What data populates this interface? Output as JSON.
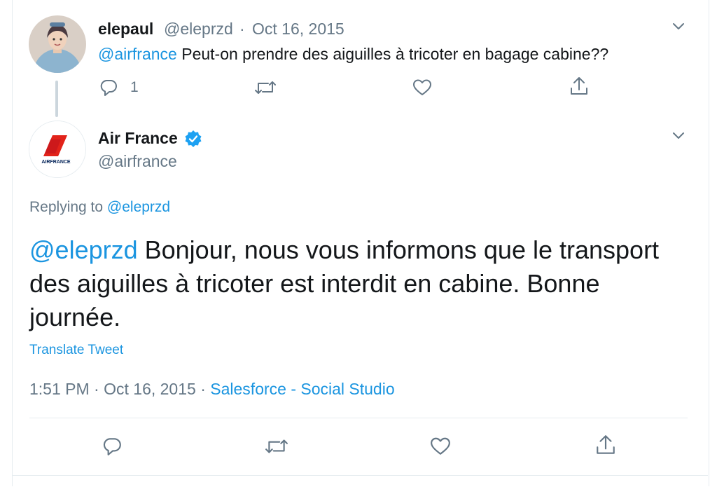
{
  "parent_tweet": {
    "name": "elepaul",
    "handle": "@eleprzd",
    "separator": "·",
    "date": "Oct 16, 2015",
    "mention": "@airfrance",
    "text": " Peut-on prendre des aiguilles à tricoter en bagage cabine??",
    "reply_count": "1",
    "icons": [
      "reply-icon",
      "retweet-icon",
      "like-icon",
      "share-icon",
      "chevron-down-icon"
    ]
  },
  "main_tweet": {
    "name": "Air France",
    "verified": true,
    "handle": "@airfrance",
    "replying_label": "Replying to ",
    "replying_handle": "@eleprzd",
    "mention": "@eleprzd",
    "text": " Bonjour, nous vous informons que le transport des aiguilles à tricoter est interdit en cabine. Bonne journée.",
    "translate_label": "Translate Tweet",
    "time": "1:51 PM",
    "separator": " · ",
    "date": "Oct 16, 2015",
    "source": "Salesforce - Social Studio",
    "logo_text": "AIRFRANCE",
    "icons": [
      "reply-icon",
      "retweet-icon",
      "like-icon",
      "share-icon",
      "chevron-down-icon",
      "verified-badge-icon"
    ]
  },
  "colors": {
    "link": "#1b95e0",
    "secondary_text": "#657786",
    "primary_text": "#14171a",
    "border": "#e6ecf0",
    "brand_red": "#e2231a",
    "verified": "#1da1f2"
  }
}
